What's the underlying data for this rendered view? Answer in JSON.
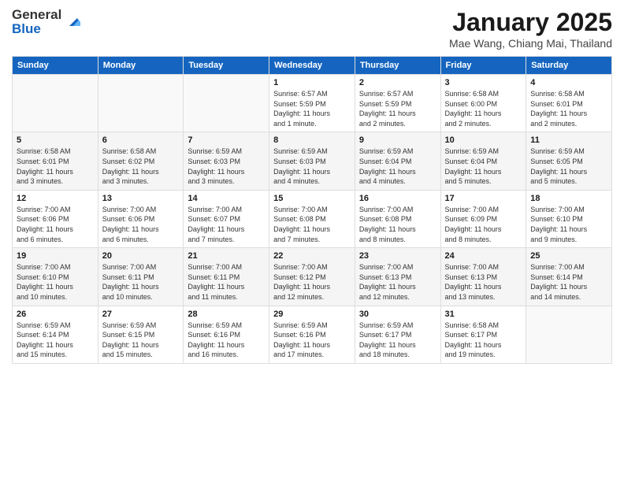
{
  "header": {
    "logo_general": "General",
    "logo_blue": "Blue",
    "month": "January 2025",
    "location": "Mae Wang, Chiang Mai, Thailand"
  },
  "weekdays": [
    "Sunday",
    "Monday",
    "Tuesday",
    "Wednesday",
    "Thursday",
    "Friday",
    "Saturday"
  ],
  "weeks": [
    [
      {
        "day": "",
        "info": ""
      },
      {
        "day": "",
        "info": ""
      },
      {
        "day": "",
        "info": ""
      },
      {
        "day": "1",
        "info": "Sunrise: 6:57 AM\nSunset: 5:59 PM\nDaylight: 11 hours\nand 1 minute."
      },
      {
        "day": "2",
        "info": "Sunrise: 6:57 AM\nSunset: 5:59 PM\nDaylight: 11 hours\nand 2 minutes."
      },
      {
        "day": "3",
        "info": "Sunrise: 6:58 AM\nSunset: 6:00 PM\nDaylight: 11 hours\nand 2 minutes."
      },
      {
        "day": "4",
        "info": "Sunrise: 6:58 AM\nSunset: 6:01 PM\nDaylight: 11 hours\nand 2 minutes."
      }
    ],
    [
      {
        "day": "5",
        "info": "Sunrise: 6:58 AM\nSunset: 6:01 PM\nDaylight: 11 hours\nand 3 minutes."
      },
      {
        "day": "6",
        "info": "Sunrise: 6:58 AM\nSunset: 6:02 PM\nDaylight: 11 hours\nand 3 minutes."
      },
      {
        "day": "7",
        "info": "Sunrise: 6:59 AM\nSunset: 6:03 PM\nDaylight: 11 hours\nand 3 minutes."
      },
      {
        "day": "8",
        "info": "Sunrise: 6:59 AM\nSunset: 6:03 PM\nDaylight: 11 hours\nand 4 minutes."
      },
      {
        "day": "9",
        "info": "Sunrise: 6:59 AM\nSunset: 6:04 PM\nDaylight: 11 hours\nand 4 minutes."
      },
      {
        "day": "10",
        "info": "Sunrise: 6:59 AM\nSunset: 6:04 PM\nDaylight: 11 hours\nand 5 minutes."
      },
      {
        "day": "11",
        "info": "Sunrise: 6:59 AM\nSunset: 6:05 PM\nDaylight: 11 hours\nand 5 minutes."
      }
    ],
    [
      {
        "day": "12",
        "info": "Sunrise: 7:00 AM\nSunset: 6:06 PM\nDaylight: 11 hours\nand 6 minutes."
      },
      {
        "day": "13",
        "info": "Sunrise: 7:00 AM\nSunset: 6:06 PM\nDaylight: 11 hours\nand 6 minutes."
      },
      {
        "day": "14",
        "info": "Sunrise: 7:00 AM\nSunset: 6:07 PM\nDaylight: 11 hours\nand 7 minutes."
      },
      {
        "day": "15",
        "info": "Sunrise: 7:00 AM\nSunset: 6:08 PM\nDaylight: 11 hours\nand 7 minutes."
      },
      {
        "day": "16",
        "info": "Sunrise: 7:00 AM\nSunset: 6:08 PM\nDaylight: 11 hours\nand 8 minutes."
      },
      {
        "day": "17",
        "info": "Sunrise: 7:00 AM\nSunset: 6:09 PM\nDaylight: 11 hours\nand 8 minutes."
      },
      {
        "day": "18",
        "info": "Sunrise: 7:00 AM\nSunset: 6:10 PM\nDaylight: 11 hours\nand 9 minutes."
      }
    ],
    [
      {
        "day": "19",
        "info": "Sunrise: 7:00 AM\nSunset: 6:10 PM\nDaylight: 11 hours\nand 10 minutes."
      },
      {
        "day": "20",
        "info": "Sunrise: 7:00 AM\nSunset: 6:11 PM\nDaylight: 11 hours\nand 10 minutes."
      },
      {
        "day": "21",
        "info": "Sunrise: 7:00 AM\nSunset: 6:11 PM\nDaylight: 11 hours\nand 11 minutes."
      },
      {
        "day": "22",
        "info": "Sunrise: 7:00 AM\nSunset: 6:12 PM\nDaylight: 11 hours\nand 12 minutes."
      },
      {
        "day": "23",
        "info": "Sunrise: 7:00 AM\nSunset: 6:13 PM\nDaylight: 11 hours\nand 12 minutes."
      },
      {
        "day": "24",
        "info": "Sunrise: 7:00 AM\nSunset: 6:13 PM\nDaylight: 11 hours\nand 13 minutes."
      },
      {
        "day": "25",
        "info": "Sunrise: 7:00 AM\nSunset: 6:14 PM\nDaylight: 11 hours\nand 14 minutes."
      }
    ],
    [
      {
        "day": "26",
        "info": "Sunrise: 6:59 AM\nSunset: 6:14 PM\nDaylight: 11 hours\nand 15 minutes."
      },
      {
        "day": "27",
        "info": "Sunrise: 6:59 AM\nSunset: 6:15 PM\nDaylight: 11 hours\nand 15 minutes."
      },
      {
        "day": "28",
        "info": "Sunrise: 6:59 AM\nSunset: 6:16 PM\nDaylight: 11 hours\nand 16 minutes."
      },
      {
        "day": "29",
        "info": "Sunrise: 6:59 AM\nSunset: 6:16 PM\nDaylight: 11 hours\nand 17 minutes."
      },
      {
        "day": "30",
        "info": "Sunrise: 6:59 AM\nSunset: 6:17 PM\nDaylight: 11 hours\nand 18 minutes."
      },
      {
        "day": "31",
        "info": "Sunrise: 6:58 AM\nSunset: 6:17 PM\nDaylight: 11 hours\nand 19 minutes."
      },
      {
        "day": "",
        "info": ""
      }
    ]
  ]
}
